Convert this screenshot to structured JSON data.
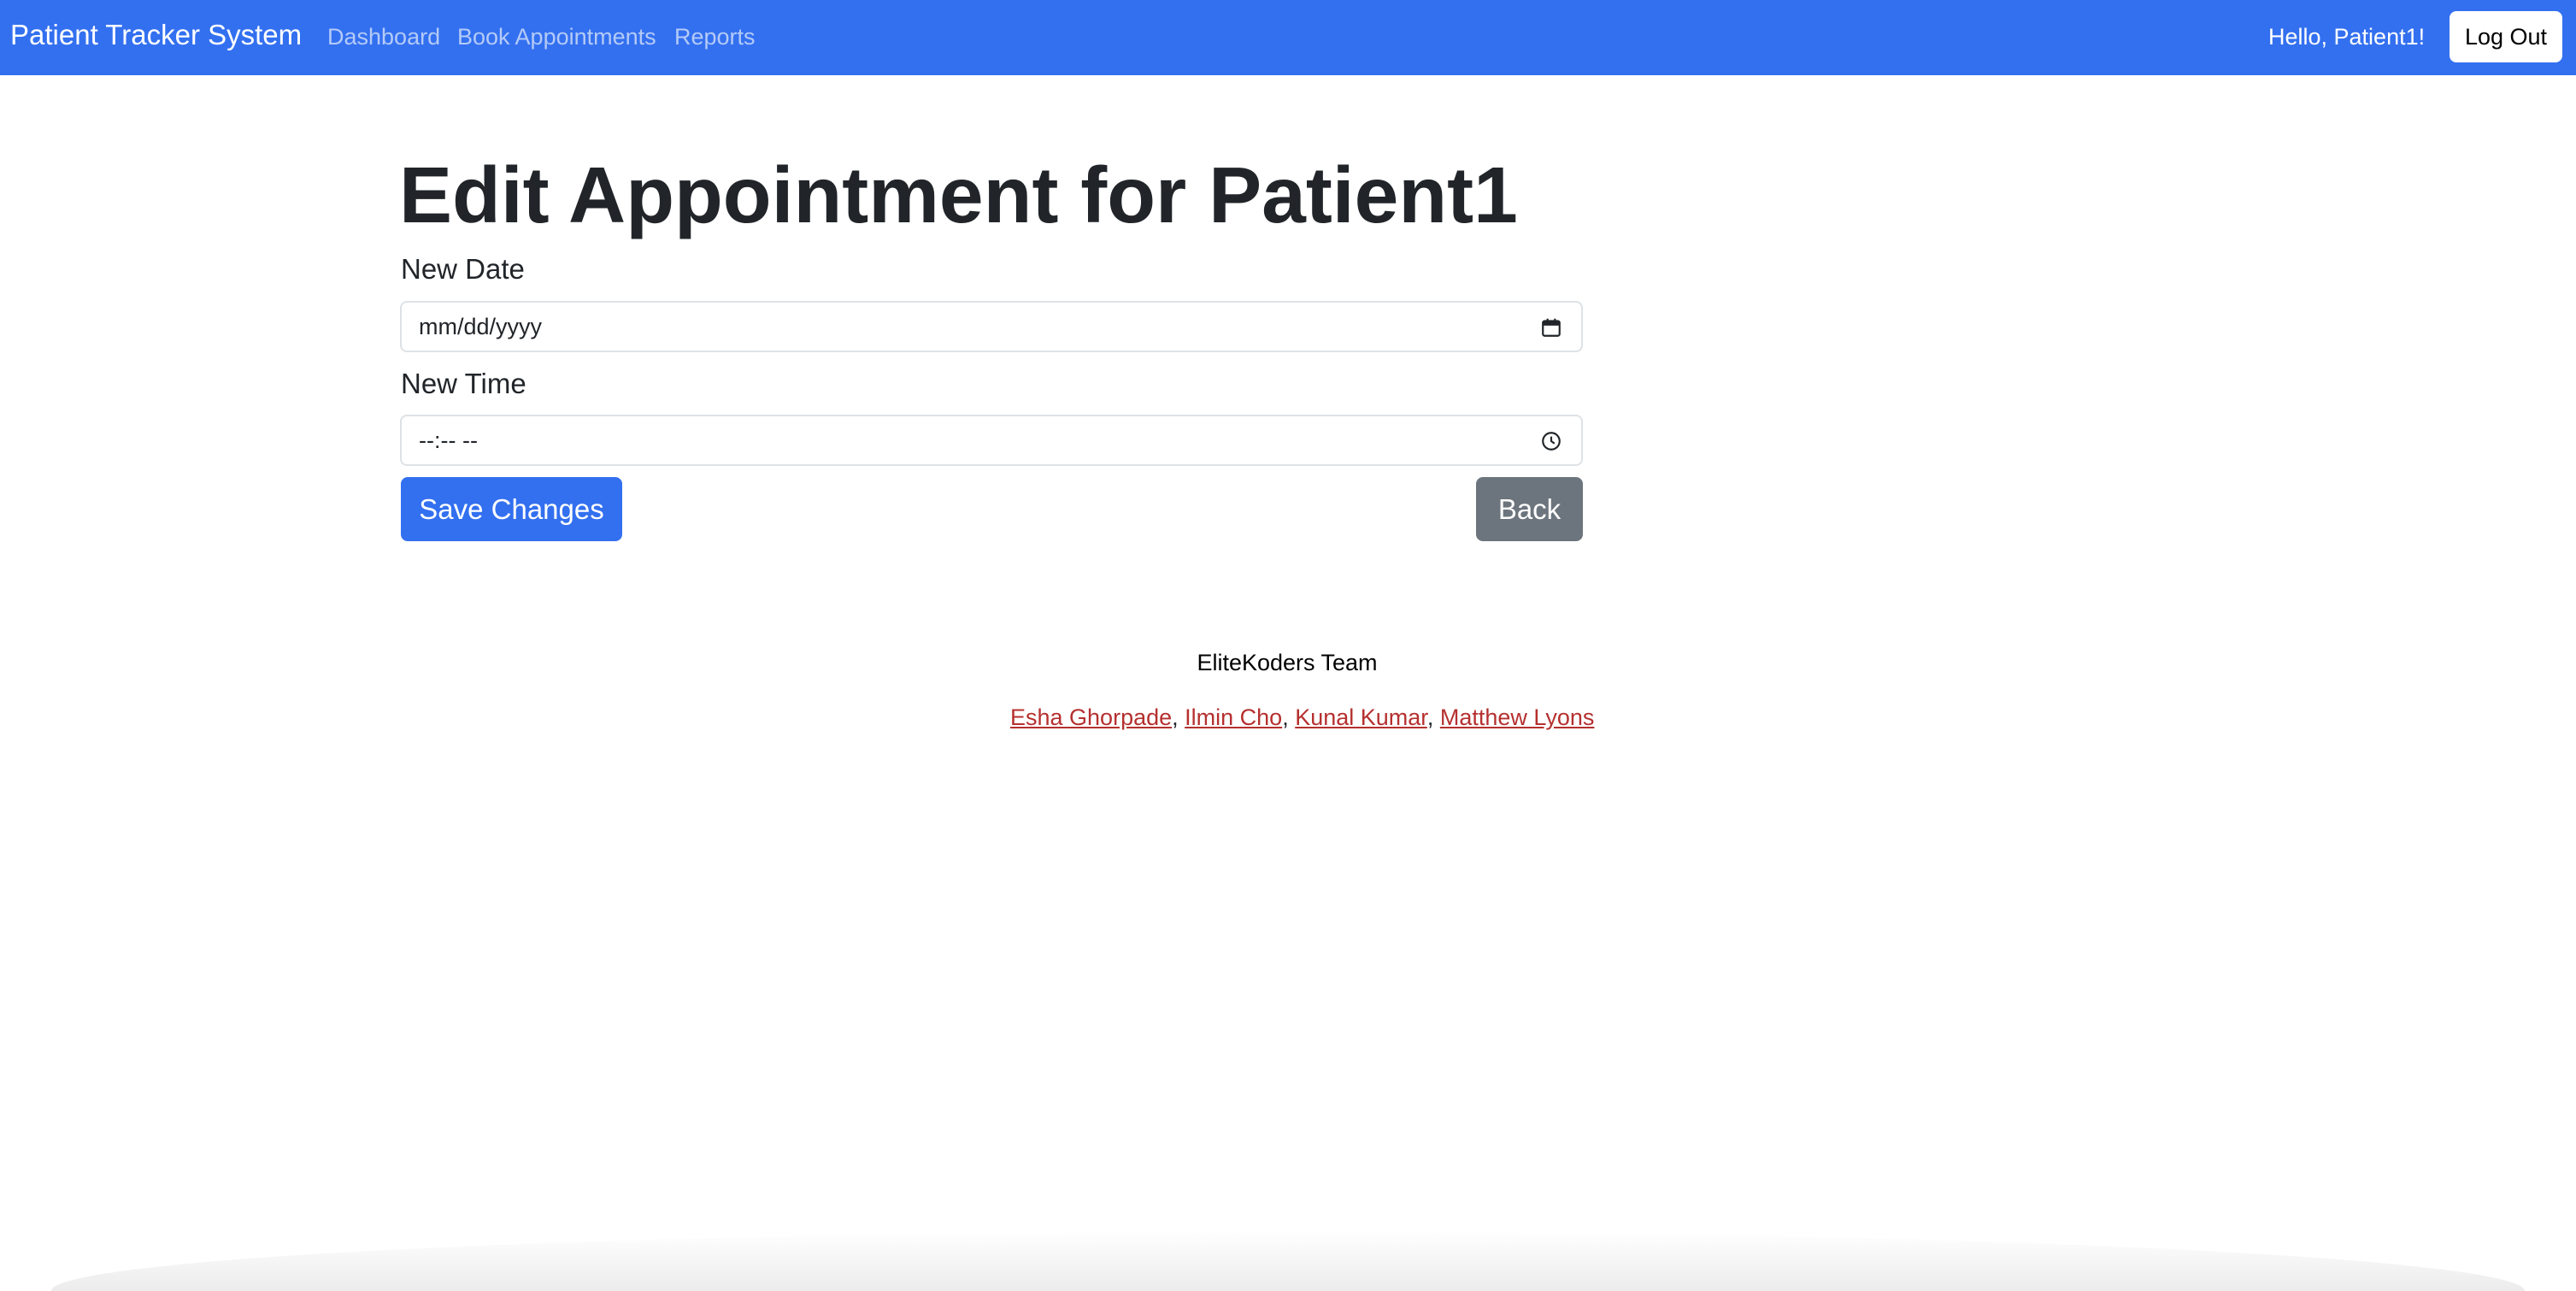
{
  "navbar": {
    "brand": "Patient Tracker System",
    "links": [
      {
        "label": "Dashboard"
      },
      {
        "label": "Book Appointments"
      },
      {
        "label": "Reports"
      }
    ],
    "greeting": "Hello, Patient1!",
    "logout_label": "Log Out",
    "color": "#3370f0"
  },
  "main": {
    "title": "Edit Appointment for Patient1",
    "date_field": {
      "label": "New Date",
      "placeholder": "mm/dd/yyyy",
      "icon": "calendar-icon"
    },
    "time_field": {
      "label": "New Time",
      "placeholder": "--:-- --",
      "icon": "clock-icon"
    },
    "save_label": "Save Changes",
    "back_label": "Back"
  },
  "footer": {
    "team": "EliteKoders Team",
    "members": [
      {
        "name": "Esha Ghorpade"
      },
      {
        "name": "Ilmin Cho"
      },
      {
        "name": "Kunal Kumar"
      },
      {
        "name": "Matthew Lyons"
      }
    ],
    "separator": ", ",
    "link_color": "#b5302f"
  }
}
